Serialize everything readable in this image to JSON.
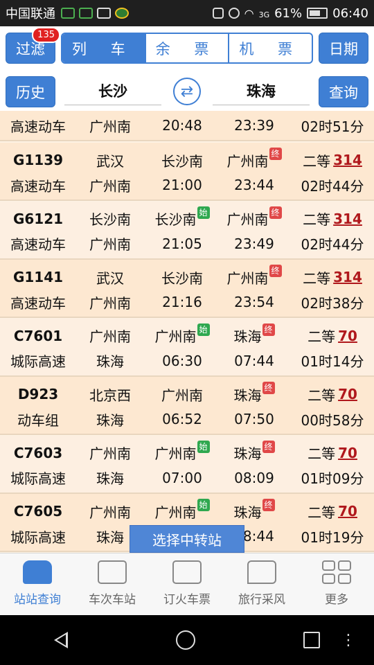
{
  "status_bar": {
    "carrier": "中国联通",
    "network": "3G",
    "battery": "61%",
    "time": "06:40"
  },
  "toolbar": {
    "filter_label": "过滤",
    "filter_badge": "135",
    "tabs": [
      "列 车",
      "余 票",
      "机 票"
    ],
    "date_label": "日期",
    "history_label": "历史",
    "from_station": "长沙",
    "to_station": "珠海",
    "query_label": "查询",
    "swap_glyph": "⇄"
  },
  "partial_row": {
    "type": "高速动车",
    "to": "广州南",
    "depart": "20:48",
    "arrive": "23:39",
    "duration": "02时51分"
  },
  "trains": [
    {
      "no": "G1139",
      "from": "武汉",
      "start_station": "长沙南",
      "start_tag": "",
      "end_station": "广州南",
      "end_tag": "终",
      "seat": "二等",
      "price": "314",
      "type": "高速动车",
      "to": "广州南",
      "depart": "21:00",
      "arrive": "23:44",
      "duration": "02时44分"
    },
    {
      "no": "G6121",
      "from": "长沙南",
      "start_station": "长沙南",
      "start_tag": "始",
      "end_station": "广州南",
      "end_tag": "终",
      "seat": "二等",
      "price": "314",
      "type": "高速动车",
      "to": "广州南",
      "depart": "21:05",
      "arrive": "23:49",
      "duration": "02时44分"
    },
    {
      "no": "G1141",
      "from": "武汉",
      "start_station": "长沙南",
      "start_tag": "",
      "end_station": "广州南",
      "end_tag": "终",
      "seat": "二等",
      "price": "314",
      "type": "高速动车",
      "to": "广州南",
      "depart": "21:16",
      "arrive": "23:54",
      "duration": "02时38分"
    },
    {
      "no": "C7601",
      "from": "广州南",
      "start_station": "广州南",
      "start_tag": "始",
      "end_station": "珠海",
      "end_tag": "终",
      "seat": "二等",
      "price": "70",
      "type": "城际高速",
      "to": "珠海",
      "depart": "06:30",
      "arrive": "07:44",
      "duration": "01时14分"
    },
    {
      "no": "D923",
      "from": "北京西",
      "start_station": "广州南",
      "start_tag": "",
      "end_station": "珠海",
      "end_tag": "终",
      "seat": "二等",
      "price": "70",
      "type": "动车组",
      "to": "珠海",
      "depart": "06:52",
      "arrive": "07:50",
      "duration": "00时58分"
    },
    {
      "no": "C7603",
      "from": "广州南",
      "start_station": "广州南",
      "start_tag": "始",
      "end_station": "珠海",
      "end_tag": "终",
      "seat": "二等",
      "price": "70",
      "type": "城际高速",
      "to": "珠海",
      "depart": "07:00",
      "arrive": "08:09",
      "duration": "01时09分"
    },
    {
      "no": "C7605",
      "from": "广州南",
      "start_station": "广州南",
      "start_tag": "始",
      "end_station": "珠海",
      "end_tag": "终",
      "seat": "二等",
      "price": "70",
      "type": "城际高速",
      "to": "珠海",
      "depart": "",
      "arrive": "08:44",
      "duration": "01时19分"
    }
  ],
  "transfer_button": "选择中转站",
  "tabbar": {
    "items": [
      {
        "label": "站站查询",
        "icon": "train-icon"
      },
      {
        "label": "车次车站",
        "icon": "briefcase-icon"
      },
      {
        "label": "订火车票",
        "icon": "ticket-icon"
      },
      {
        "label": "旅行采风",
        "icon": "chat-icon"
      },
      {
        "label": "更多",
        "icon": "grid-icon"
      }
    ]
  },
  "navbar": {
    "more_glyph": "⋮"
  }
}
